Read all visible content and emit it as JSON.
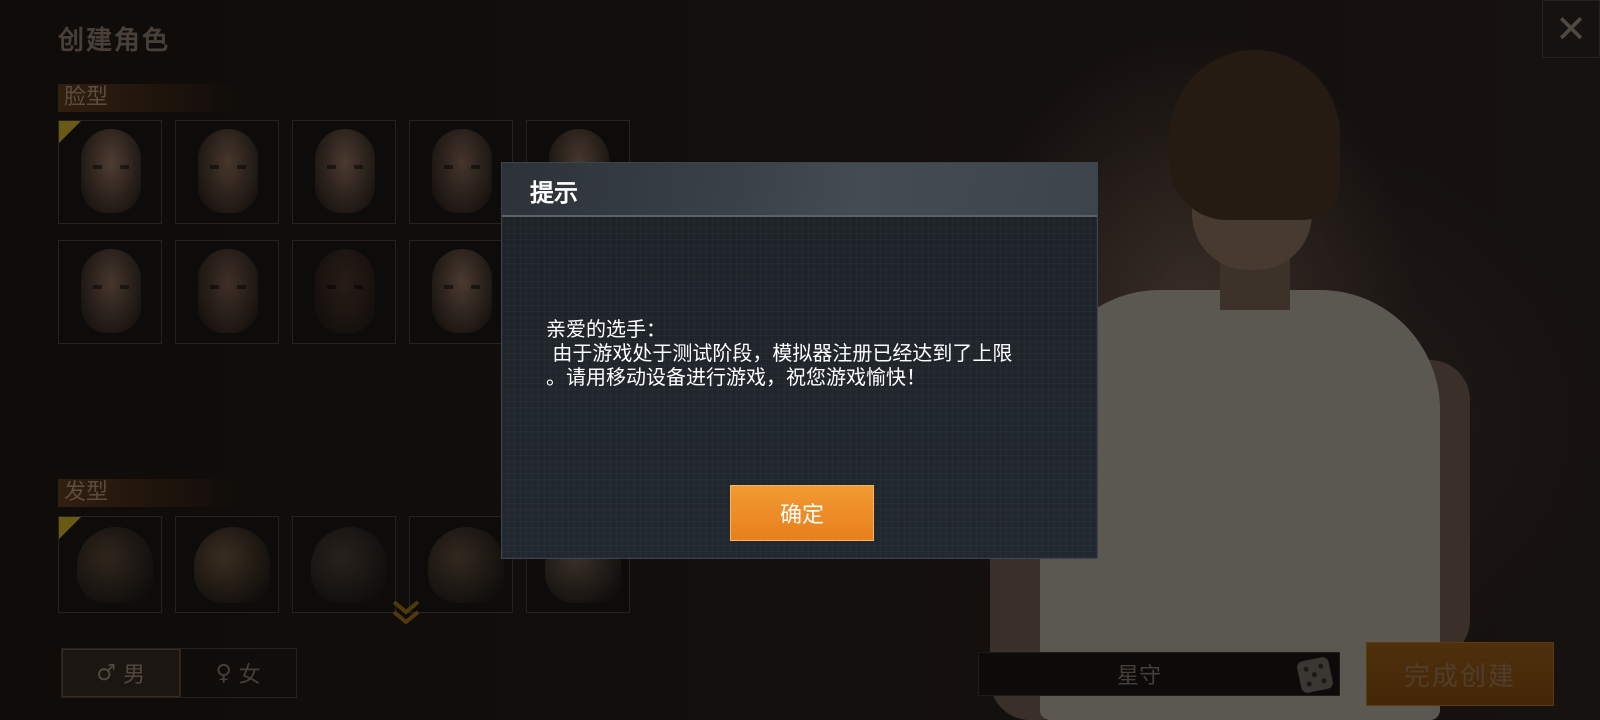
{
  "screen_title": "创建角色",
  "close_icon": "✕",
  "sections": {
    "face_label": "脸型",
    "hair_label": "发型"
  },
  "face_thumbs": [
    {
      "selected": true,
      "skin": "#7a5e4e"
    },
    {
      "selected": false,
      "skin": "#6e5444"
    },
    {
      "selected": false,
      "skin": "#745a4a"
    },
    {
      "selected": false,
      "skin": "#6a5244"
    },
    {
      "selected": false,
      "skin": "#6e5648"
    },
    {
      "selected": false,
      "skin": "#6c5446"
    },
    {
      "selected": false,
      "skin": "#624a3c"
    },
    {
      "selected": false,
      "skin": "#3e2c22"
    },
    {
      "selected": false,
      "skin": "#725a4a"
    },
    {
      "selected": false,
      "skin": "#3a2a20"
    }
  ],
  "hair_thumbs": [
    {
      "selected": true,
      "color": "#4a3a2c"
    },
    {
      "selected": false,
      "color": "#5a4632"
    },
    {
      "selected": false,
      "color": "#3e342c"
    },
    {
      "selected": false,
      "color": "#4e3e30"
    },
    {
      "selected": false,
      "color": "#5a4a3e"
    }
  ],
  "scroll_icon": "chevron-down-icon",
  "gender": {
    "male_symbol": "♂",
    "male_label": "男",
    "female_symbol": "♀",
    "female_label": "女",
    "selected": "male"
  },
  "name_field": {
    "value": "星守",
    "random_icon": "dice-icon"
  },
  "finish_button": "完成创建",
  "modal": {
    "title": "提示",
    "message": "亲爱的选手：\n 由于游戏处于测试阶段，模拟器注册已经达到了上限\n。请用移动设备进行游戏，祝您游戏愉快！",
    "confirm_label": "确定"
  },
  "colors": {
    "accent_orange": "#ee8c26",
    "modal_bg": "#1f252b"
  }
}
